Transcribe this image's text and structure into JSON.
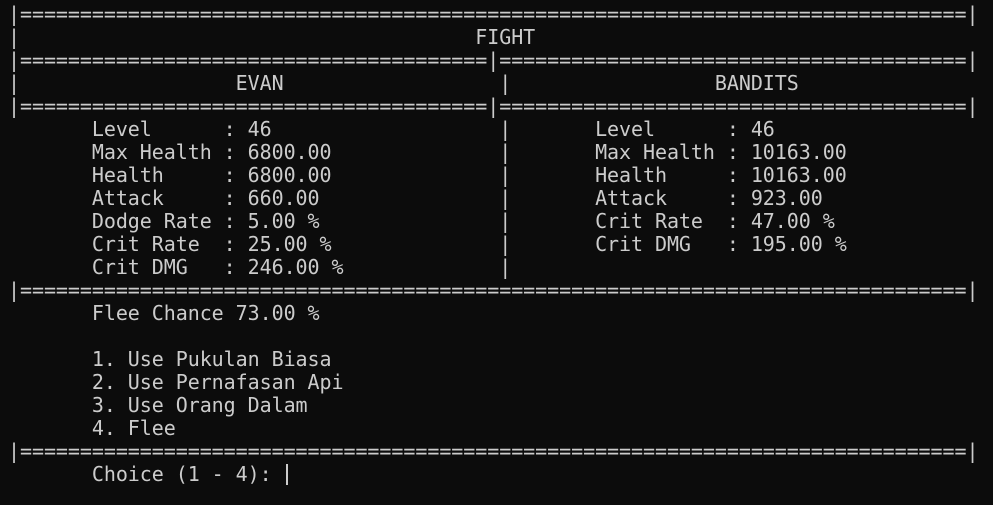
{
  "screen": {
    "border": "|===============================================================================|",
    "title_row": "|                                      FIGHT                                      |",
    "split_border": "|=======================================|=======================================|",
    "names_row": "|                  EVAN                  |                 BANDITS                 |",
    "stats_rows": [
      "       Level      : 46                   |       Level      : 46",
      "       Max Health : 6800.00              |       Max Health : 10163.00",
      "       Health     : 6800.00              |       Health     : 10163.00",
      "       Attack     : 660.00               |       Attack     : 923.00",
      "       Dodge Rate : 5.00 %               |       Crit Rate  : 47.00 %",
      "       Crit Rate  : 25.00 %              |       Crit DMG   : 195.00 %",
      "       Crit DMG   : 246.00 %             |"
    ],
    "flee_line": "       Flee Chance 73.00 %",
    "blank_line": "",
    "menu_options": [
      "       1. Use Pukulan Biasa",
      "       2. Use Pernafasan Api",
      "       3. Use Orang Dalam",
      "       4. Flee"
    ],
    "prompt": "       Choice (1 - 4): "
  }
}
